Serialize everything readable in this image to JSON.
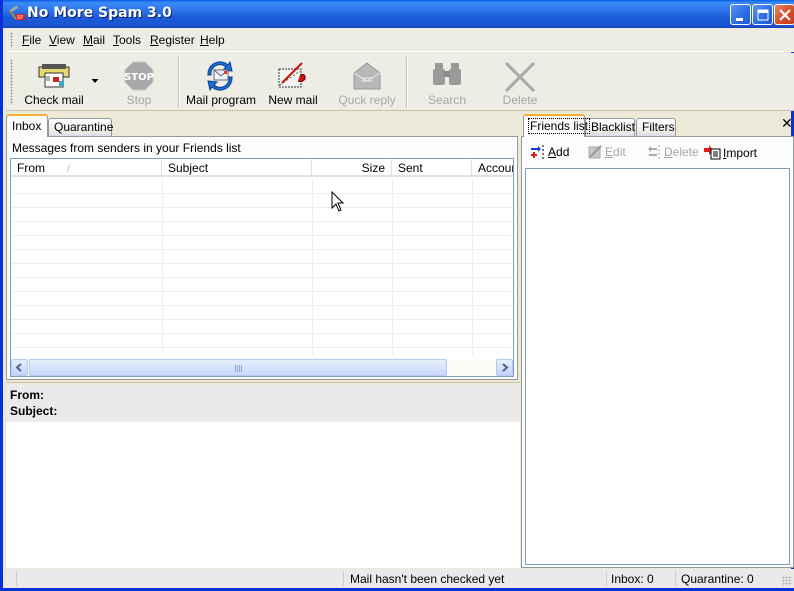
{
  "window": {
    "title": "No More Spam 3.0",
    "controls": {
      "minimize": "minimize",
      "maximize": "maximize",
      "close": "close"
    }
  },
  "menubar": {
    "items": [
      {
        "label": "File",
        "accel": "F",
        "rest": "ile"
      },
      {
        "label": "View",
        "accel": "V",
        "rest": "iew"
      },
      {
        "label": "Mail",
        "accel": "M",
        "rest": "ail"
      },
      {
        "label": "Tools",
        "accel": "T",
        "rest": "ools"
      },
      {
        "label": "Register",
        "accel": "R",
        "rest": "egister"
      },
      {
        "label": "Help",
        "accel": "H",
        "rest": "elp"
      }
    ]
  },
  "toolbar": {
    "buttons": [
      {
        "label": "Check mail",
        "icon": "check-mail-icon",
        "enabled": true,
        "has_dropdown": true
      },
      {
        "label": "Stop",
        "icon": "stop-sign-icon",
        "enabled": false
      },
      {
        "label": "Mail program",
        "icon": "mail-program-icon",
        "enabled": true
      },
      {
        "label": "New mail",
        "icon": "new-mail-icon",
        "enabled": true
      },
      {
        "label": "Quck reply",
        "icon": "quick-reply-icon",
        "enabled": false
      },
      {
        "label": "Search",
        "icon": "binoculars-icon",
        "enabled": false
      },
      {
        "label": "Delete",
        "icon": "delete-x-icon",
        "enabled": false
      }
    ]
  },
  "left_panel": {
    "tabs": [
      {
        "label": "Inbox",
        "active": true
      },
      {
        "label": "Quarantine",
        "active": false
      }
    ],
    "info": "Messages from senders in your Friends list",
    "columns": [
      {
        "label": "From",
        "sorted": true
      },
      {
        "label": "Subject"
      },
      {
        "label": "Size"
      },
      {
        "label": "Sent"
      },
      {
        "label": "Accour"
      }
    ],
    "sort_glyph": "/",
    "rows": []
  },
  "preview": {
    "from_label": "From:",
    "subject_label": "Subject:",
    "from_value": "",
    "subject_value": ""
  },
  "right_panel": {
    "tabs": [
      {
        "label": "Friends list",
        "active": true
      },
      {
        "label": "Blacklist",
        "active": false
      },
      {
        "label": "Filters",
        "active": false
      }
    ],
    "close_glyph": "✕",
    "tools": [
      {
        "label": "Add",
        "accel": "A",
        "rest": "dd",
        "enabled": true
      },
      {
        "label": "Edit",
        "accel": "E",
        "rest": "dit",
        "enabled": false
      },
      {
        "label": "Delete",
        "accel": "D",
        "rest": "elete",
        "enabled": false
      },
      {
        "label": "Import",
        "accel": "I",
        "rest": "mport",
        "enabled": true
      }
    ],
    "items": []
  },
  "statusbar": {
    "message": "Mail hasn't been checked yet",
    "inbox": "Inbox: 0",
    "quarantine": "Quarantine: 0"
  },
  "colors": {
    "titlebar": "#1d5bd8",
    "accent_tab": "#f7b031",
    "disabled_text": "#a7a6aa"
  }
}
